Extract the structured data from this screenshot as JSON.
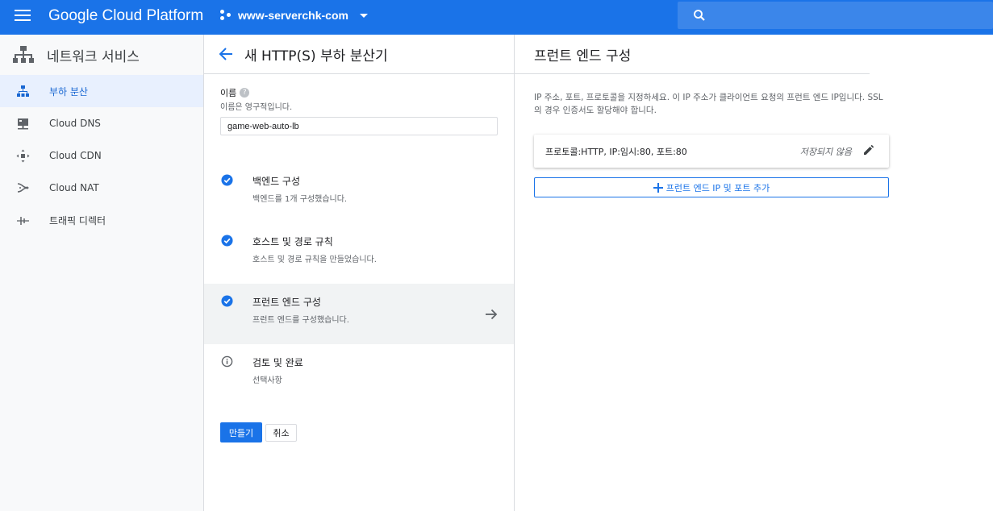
{
  "topbar": {
    "brand": "Google Cloud Platform",
    "project": "www-serverchk-com",
    "colors": {
      "bar": "#1a73e8",
      "search": "#3b86ea"
    }
  },
  "leftnav": {
    "title": "네트워크 서비스",
    "items": [
      {
        "label": "부하 분산",
        "icon": "load-balancing-icon",
        "active": true
      },
      {
        "label": "Cloud DNS",
        "icon": "dns-icon"
      },
      {
        "label": "Cloud CDN",
        "icon": "cdn-icon"
      },
      {
        "label": "Cloud NAT",
        "icon": "nat-icon"
      },
      {
        "label": "트래픽 디렉터",
        "icon": "traffic-director-icon"
      }
    ]
  },
  "middle": {
    "title": "새 HTTP(S) 부하 분산기",
    "name_field": {
      "label": "이름",
      "hint": "이름은 영구적입니다.",
      "value": "game-web-auto-lb"
    },
    "steps": [
      {
        "title": "백엔드 구성",
        "sub": "백엔드를 1개 구성했습니다.",
        "icon": "check-circle-icon"
      },
      {
        "title": "호스트 및 경로 규칙",
        "sub": "호스트 및 경로 규칙을 만들었습니다.",
        "icon": "check-circle-icon"
      },
      {
        "title": "프런트 엔드 구성",
        "sub": "프런트 엔드를 구성했습니다.",
        "icon": "check-circle-icon",
        "active": true
      },
      {
        "title": "검토 및 완료",
        "sub": "선택사항",
        "icon": "info-icon"
      }
    ],
    "create_label": "만들기",
    "cancel_label": "취소"
  },
  "right": {
    "title": "프런트 엔드 구성",
    "description": "IP 주소, 포트, 프로토콜을 지정하세요. 이 IP 주소가 클라이언트 요청의 프런트 엔드 IP입니다. SSL의 경우 인증서도 할당해야 합니다.",
    "frontend": {
      "summary": "프로토콜:HTTP, IP:임시:80, 포트:80",
      "status": "저장되지 않음"
    },
    "add_label": "프런트 엔드 IP 및 포트 추가"
  }
}
